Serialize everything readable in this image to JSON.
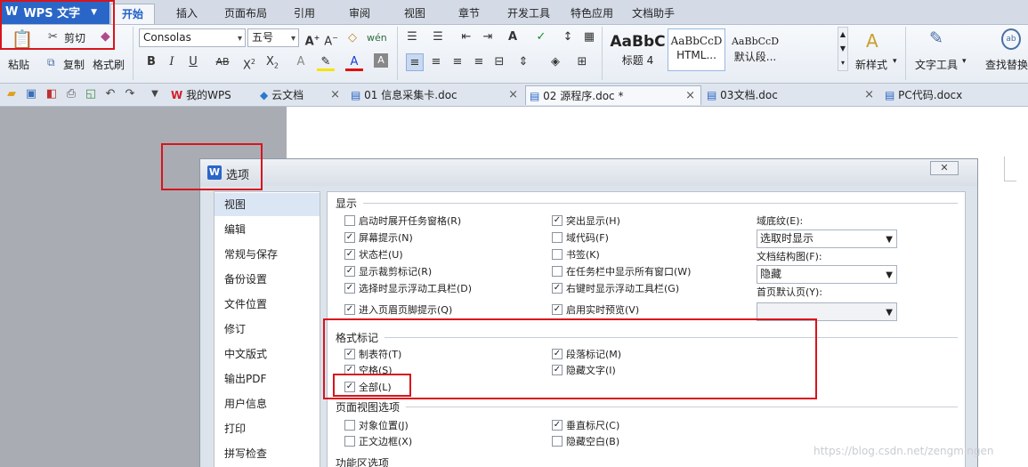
{
  "app": {
    "name": "WPS 文字"
  },
  "menu_tabs": [
    "开始",
    "插入",
    "页面布局",
    "引用",
    "审阅",
    "视图",
    "章节",
    "开发工具",
    "特色应用",
    "文档助手"
  ],
  "ribbon": {
    "paste": "粘贴",
    "cut": "剪切",
    "copy": "复制",
    "format_painter": "格式刷",
    "font_name": "Consolas",
    "font_size": "五号",
    "styles": [
      {
        "sample": "AaBbC",
        "label": "标题 4"
      },
      {
        "sample": "AaBbCcD",
        "label": "HTML..."
      },
      {
        "sample": "AaBbCcD",
        "label": "默认段..."
      }
    ],
    "new_style": "新样式",
    "text_tools": "文字工具",
    "find_replace": "查找替换"
  },
  "doc_tabs": [
    {
      "label": "我的WPS"
    },
    {
      "label": "云文档"
    },
    {
      "label": "01 信息采集卡.doc"
    },
    {
      "label": "02 源程序.doc *"
    },
    {
      "label": "03文档.doc"
    },
    {
      "label": "PC代码.docx"
    }
  ],
  "dialog": {
    "title": "选项",
    "nav": [
      "视图",
      "编辑",
      "常规与保存",
      "备份设置",
      "文件位置",
      "修订",
      "中文版式",
      "输出PDF",
      "用户信息",
      "打印",
      "拼写检查"
    ],
    "sections": {
      "display": "显示",
      "format_marks": "格式标记",
      "page_view": "页面视图选项",
      "function_area": "功能区选项"
    },
    "display": {
      "col1": [
        {
          "label": "启动时展开任务窗格(R)",
          "checked": false
        },
        {
          "label": "屏幕提示(N)",
          "checked": true
        },
        {
          "label": "状态栏(U)",
          "checked": true
        },
        {
          "label": "显示裁剪标记(R)",
          "checked": true
        },
        {
          "label": "选择时显示浮动工具栏(D)",
          "checked": true
        },
        {
          "label": "进入页眉页脚提示(Q)",
          "checked": true
        }
      ],
      "col2": [
        {
          "label": "突出显示(H)",
          "checked": true
        },
        {
          "label": "域代码(F)",
          "checked": false
        },
        {
          "label": "书签(K)",
          "checked": false
        },
        {
          "label": "在任务栏中显示所有窗口(W)",
          "checked": false
        },
        {
          "label": "右键时显示浮动工具栏(G)",
          "checked": true
        },
        {
          "label": "启用实时预览(V)",
          "checked": true
        }
      ],
      "selects": [
        {
          "label": "域底纹(E):",
          "value": "选取时显示"
        },
        {
          "label": "文档结构图(F):",
          "value": "隐藏"
        },
        {
          "label": "首页默认页(Y):",
          "value": ""
        }
      ]
    },
    "format_marks": {
      "col1": [
        {
          "label": "制表符(T)",
          "checked": true
        },
        {
          "label": "空格(S)",
          "checked": true
        },
        {
          "label": "全部(L)",
          "checked": true
        }
      ],
      "col2": [
        {
          "label": "段落标记(M)",
          "checked": true
        },
        {
          "label": "隐藏文字(I)",
          "checked": true
        }
      ]
    },
    "page_view": {
      "col1": [
        {
          "label": "对象位置(J)",
          "checked": false
        },
        {
          "label": "正文边框(X)",
          "checked": false
        }
      ],
      "col2": [
        {
          "label": "垂直标尺(C)",
          "checked": true
        },
        {
          "label": "隐藏空白(B)",
          "checked": false
        }
      ]
    }
  },
  "watermark": "https://blog.csdn.net/zengmingen"
}
